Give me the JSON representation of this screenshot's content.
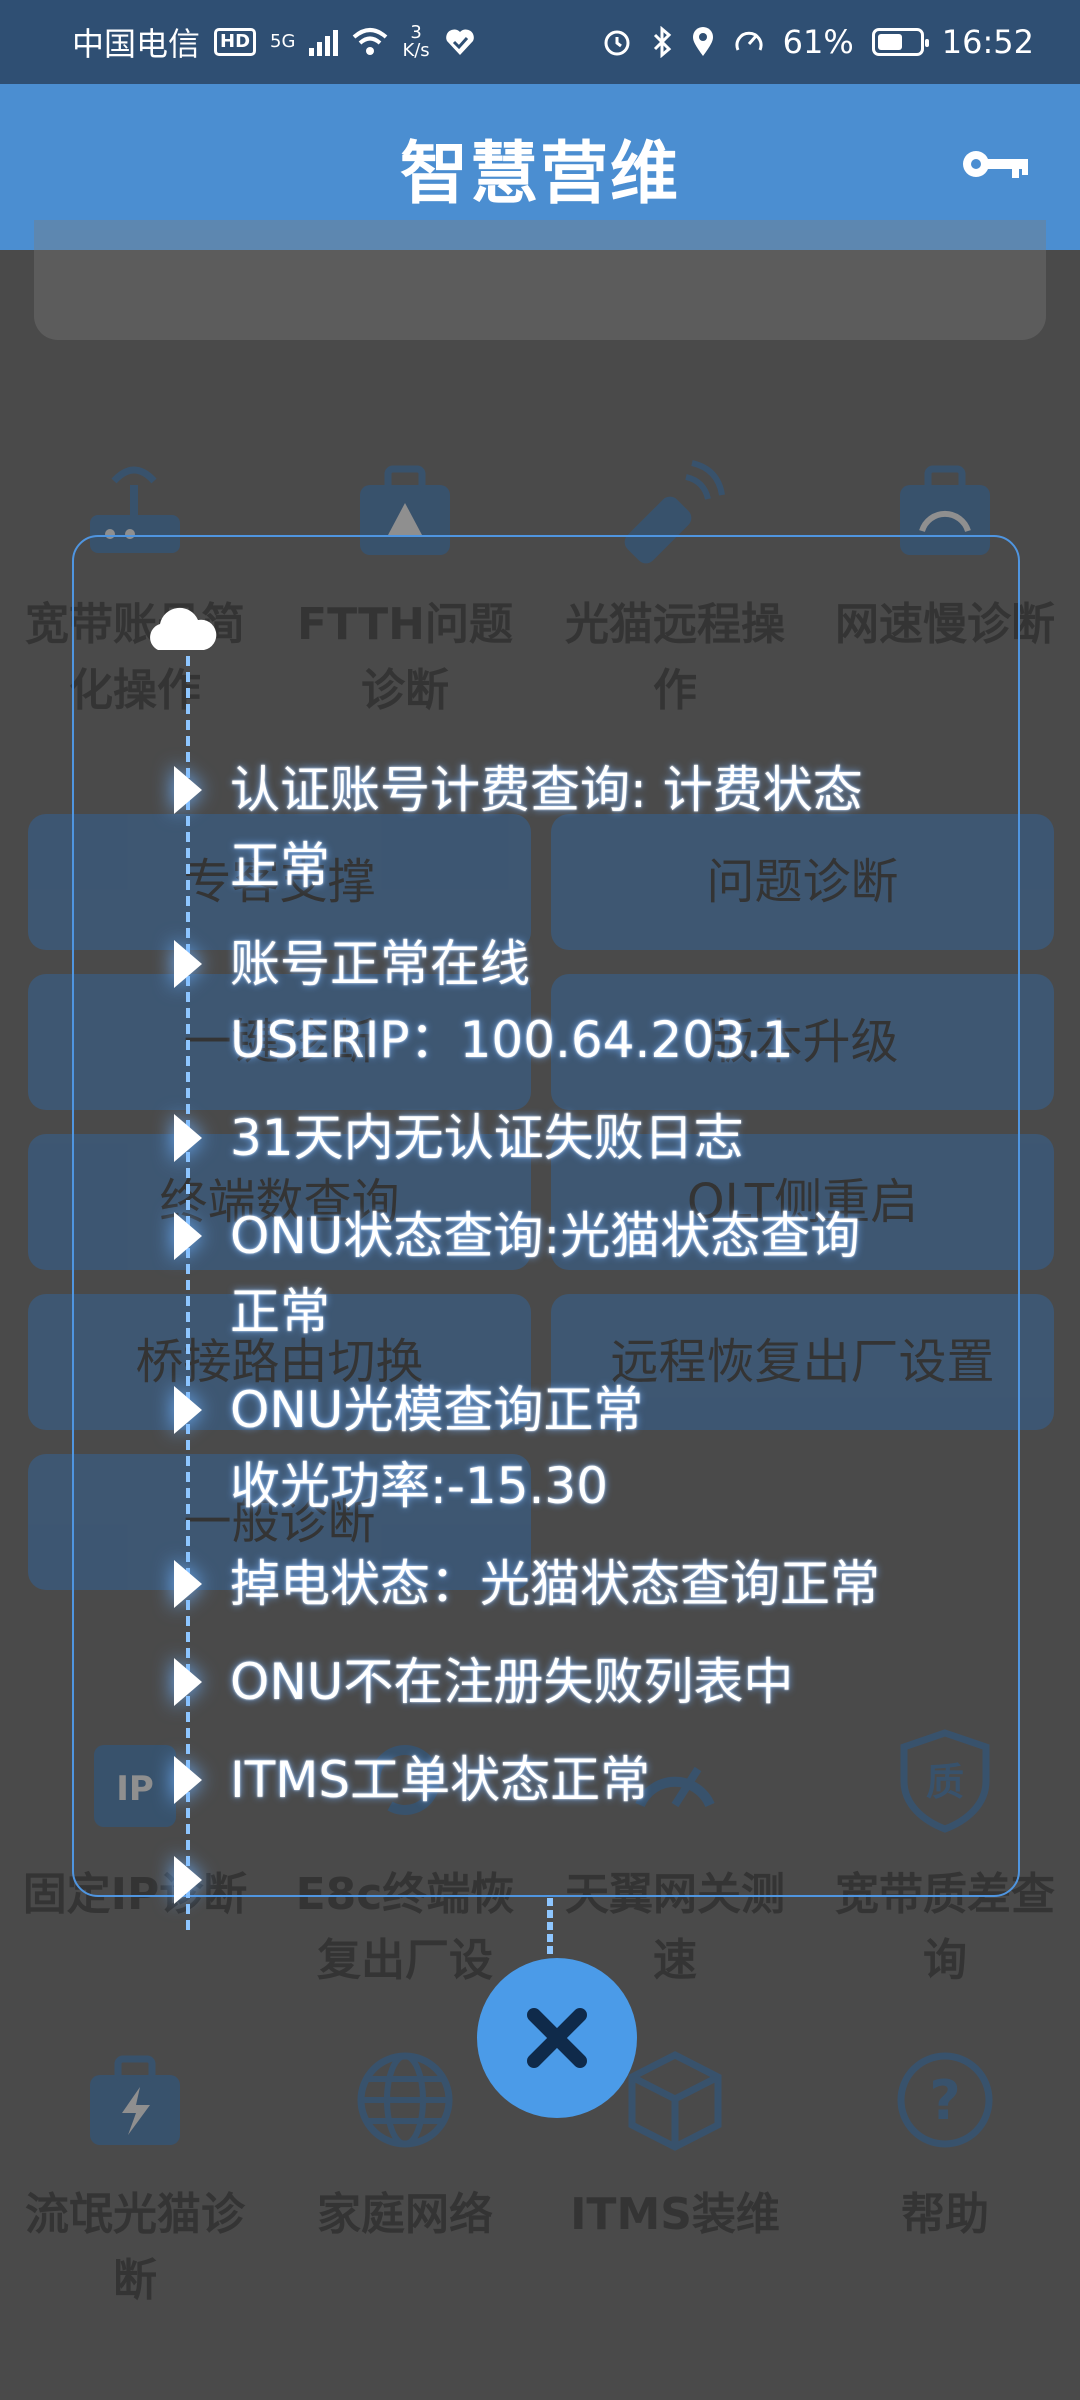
{
  "status_bar": {
    "carrier": "中国电信",
    "hd": "HD",
    "network": "5G",
    "speed_value": "3",
    "speed_unit": "K/s",
    "battery": "61%",
    "battery_level": 0.61,
    "time": "16:52"
  },
  "header": {
    "title": "智慧营维"
  },
  "background": {
    "row1": [
      {
        "label": "宽带账号简化操作",
        "icon": "router-icon"
      },
      {
        "label": "FTTH问题诊断",
        "icon": "toolbox-alert-icon"
      },
      {
        "label": "光猫远程操作",
        "icon": "remote-control-icon"
      },
      {
        "label": "网速慢诊断",
        "icon": "toolbox-speed-icon"
      }
    ],
    "buttons": [
      "专客支撑",
      "问题诊断",
      "一键诊断",
      "版本升级",
      "终端数查询",
      "OLT侧重启",
      "桥接路由切换",
      "远程恢复出厂设置",
      "一般诊断"
    ],
    "row2": [
      {
        "label": "固定IP诊断",
        "icon": "ip-icon"
      },
      {
        "label": "E8c终端恢复出厂设",
        "icon": "reset-icon"
      },
      {
        "label": "天翼网关测速",
        "icon": "speed-test-icon"
      },
      {
        "label": "宽带质差查询",
        "icon": "quality-shield-icon"
      }
    ],
    "row3": [
      {
        "label": "流氓光猫诊断",
        "icon": "toolbox-bolt-icon"
      },
      {
        "label": "家庭网络",
        "icon": "globe-icon"
      },
      {
        "label": "ITMS装维",
        "icon": "box-icon"
      },
      {
        "label": "帮助",
        "icon": "help-icon"
      }
    ]
  },
  "diagnosis": {
    "steps": [
      {
        "line1": "认证账号计费查询: 计费状态",
        "line2": "正常"
      },
      {
        "line1": "账号正常在线",
        "line2": "USERIP：100.64.203.1"
      },
      {
        "line1": "31天内无认证失败日志",
        "line2": ""
      },
      {
        "line1": "ONU状态查询:光猫状态查询",
        "line2": "正常"
      },
      {
        "line1": "ONU光模查询正常",
        "line2": "收光功率:-15.30"
      },
      {
        "line1": "掉电状态：光猫状态查询正常",
        "line2": ""
      },
      {
        "line1": "ONU不在注册失败列表中",
        "line2": ""
      },
      {
        "line1": "ITMS工单状态正常",
        "line2": ""
      }
    ]
  },
  "colors": {
    "header": "#4b8ed1",
    "status_bar": "#2f4f73",
    "accent": "#4b9be8",
    "button": "#2b6db5"
  }
}
